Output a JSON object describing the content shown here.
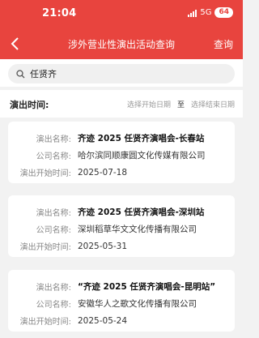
{
  "status": {
    "time": "21:04",
    "network": "5G",
    "battery": "64"
  },
  "nav": {
    "title": "涉外营业性演出活动查询",
    "action": "查询"
  },
  "search": {
    "value": "任贤齐"
  },
  "filter": {
    "label": "演出时间:",
    "start_placeholder": "选择开始日期",
    "to": "至",
    "end_placeholder": "选择结束日期"
  },
  "labels": {
    "name": "演出名称:",
    "company": "公司名称:",
    "start": "演出开始时间:"
  },
  "results": [
    {
      "name": "齐迹 2025 任贤齐演唱会-长春站",
      "company": "哈尔滨同顺康圆文化传媒有限公司",
      "start": "2025-07-18"
    },
    {
      "name": "齐迹 2025 任贤齐演唱会-深圳站",
      "company": "深圳稻草华文文化传播有限公司",
      "start": "2025-05-31"
    },
    {
      "name": "“齐迹 2025 任贤齐演唱会-昆明站”",
      "company": "安徽华人之歌文化传播有限公司",
      "start": "2025-05-24"
    }
  ]
}
